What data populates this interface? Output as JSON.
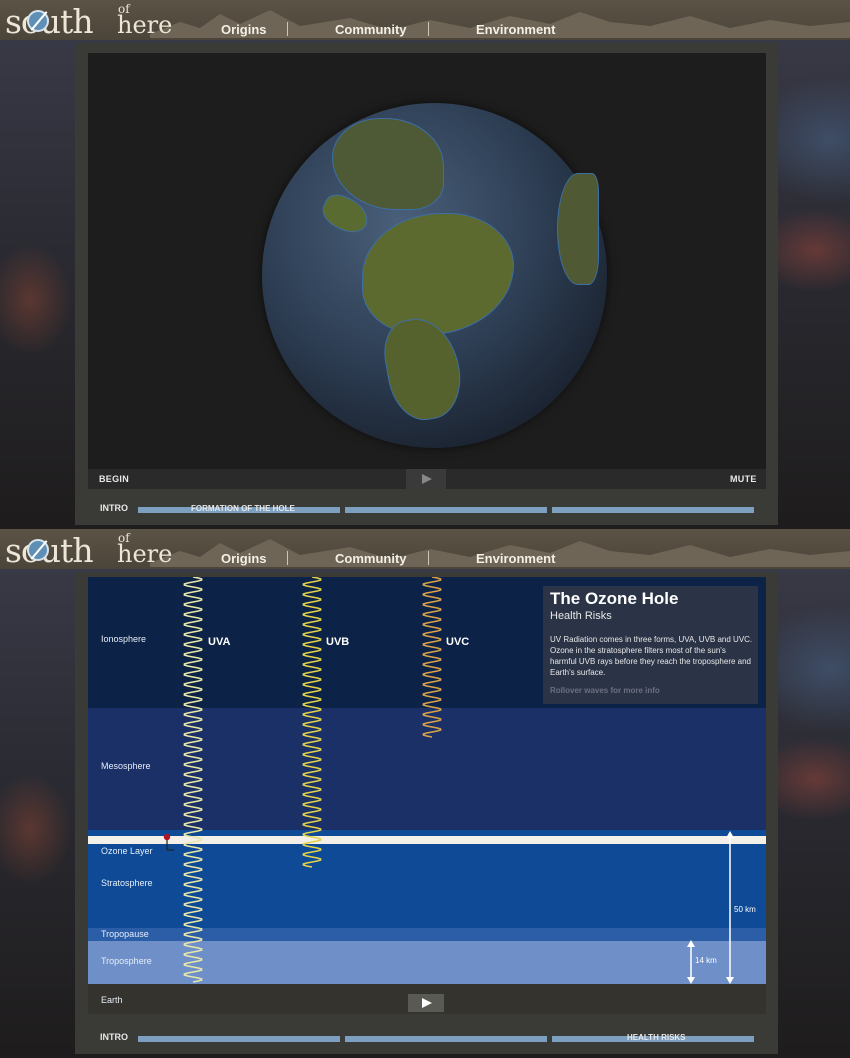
{
  "header": {
    "logo_main": "south",
    "logo_of": "of",
    "logo_here": "here",
    "nav": [
      "Origins",
      "Community",
      "Environment"
    ]
  },
  "panel1": {
    "controls": {
      "begin": "BEGIN",
      "mute": "MUTE"
    },
    "timeline": {
      "intro": "INTRO",
      "segment_label": "FORMATION OF THE HOLE"
    }
  },
  "panel2": {
    "info": {
      "title": "The Ozone Hole",
      "subtitle": "Health Risks",
      "body": "UV Radiation comes in three forms, UVA, UVB and UVC. Ozone in the stratosphere filters most of the sun's harmful UVB rays before they reach the troposphere and Earth's surface.",
      "hint": "Rollover waves for more info"
    },
    "waves": [
      "UVA",
      "UVB",
      "UVC"
    ],
    "layers": {
      "ionosphere": "Ionosphere",
      "mesosphere": "Mesosphere",
      "ozone": "Ozone Layer",
      "stratosphere": "Stratosphere",
      "tropopause": "Tropopause",
      "troposphere": "Troposphere",
      "earth": "Earth"
    },
    "distances": {
      "d50": "50 km",
      "d14": "14 km"
    },
    "timeline": {
      "intro": "INTRO",
      "segment_label": "HEALTH RISKS"
    }
  },
  "colors": {
    "ionosphere": "#0c2246",
    "mesosphere": "#1a3066",
    "stratosphere": "#0e4a96",
    "tropopause": "#2c5ea8",
    "troposphere": "#6f8fc9",
    "earth": "#35332d",
    "ozone": "#f2f0e8",
    "timeline": "#7ea0c0"
  }
}
